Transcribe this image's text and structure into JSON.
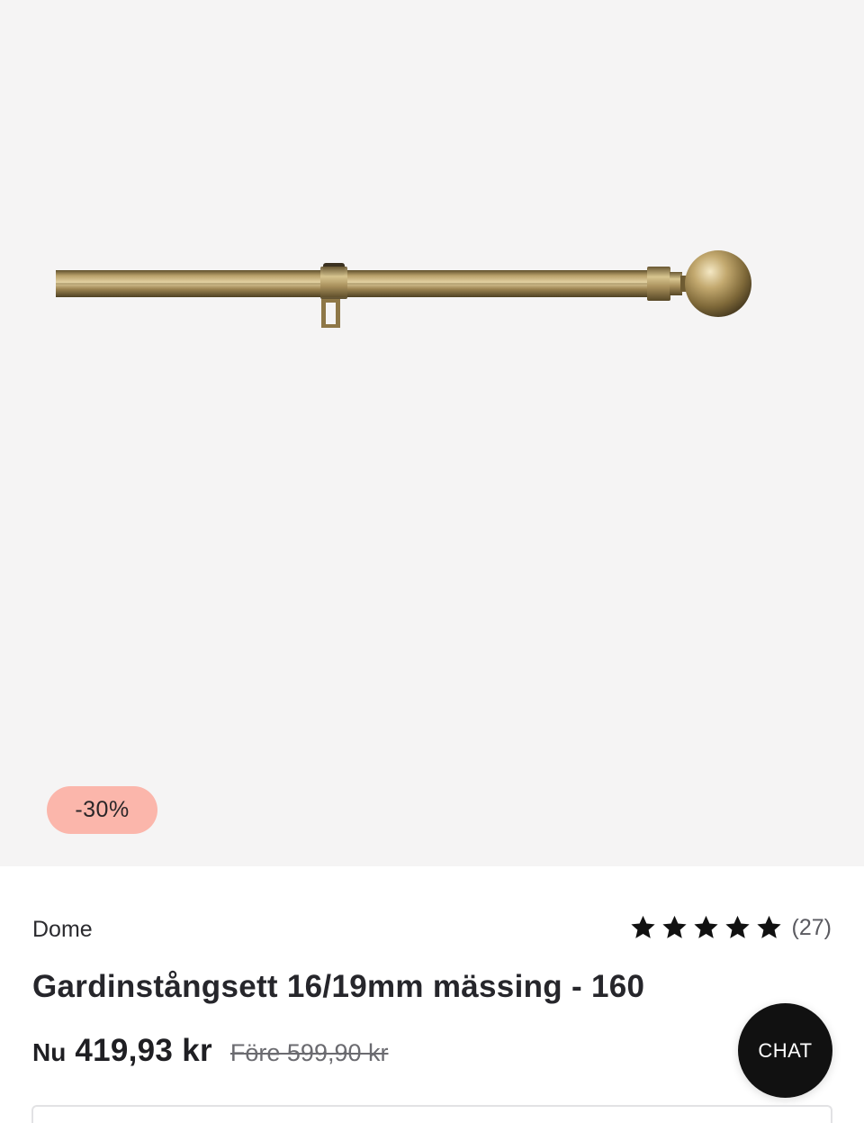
{
  "product": {
    "image_alt": "Gardinstångsett 16/19mm mässing",
    "discount_badge": "-30%",
    "brand": "Dome",
    "rating": {
      "stars": 5,
      "max_stars": 5,
      "count_label": "(27)"
    },
    "title": "Gardinstångsett 16/19mm mässing - 160",
    "price": {
      "prefix": "Nu",
      "current": "419,93 kr",
      "before": "Före 599,90 kr"
    }
  },
  "chat": {
    "label": "CHAT"
  },
  "colors": {
    "image_background": "#f5f4f4",
    "discount_badge": "#fbb6ab",
    "chat_button": "#111111",
    "brass": "#9c8350"
  },
  "icons": {
    "rating_star": "star-icon"
  }
}
